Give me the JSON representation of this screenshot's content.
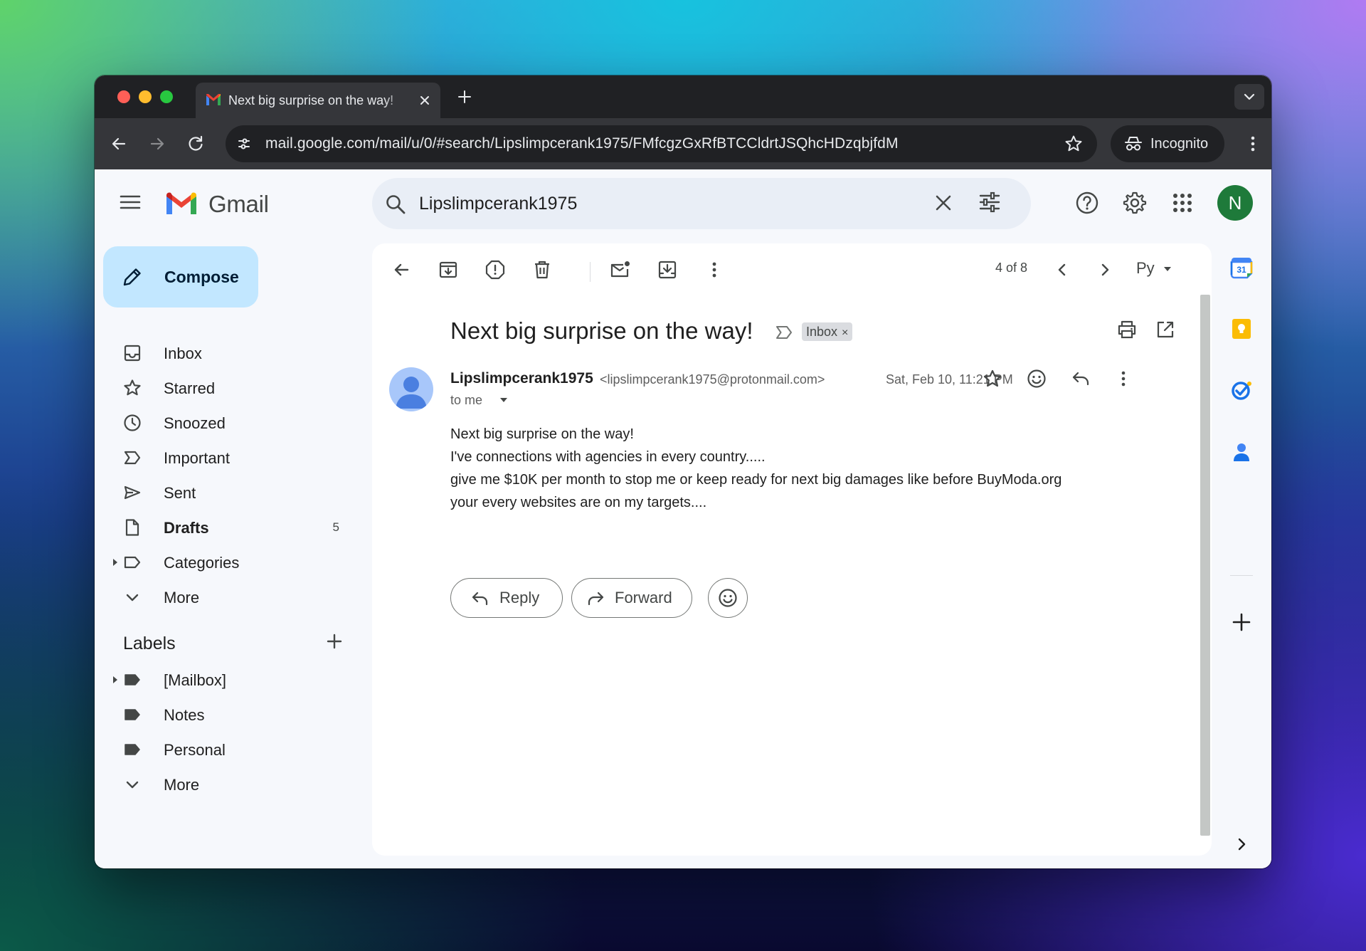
{
  "browser": {
    "tab_title": "Next big surprise on the way!",
    "url": "mail.google.com/mail/u/0/#search/Lipslimpcerank1975/FMfcgzGxRfBTCCldrtJSQhcHDzqbjfdM",
    "incognito_label": "Incognito"
  },
  "gmail": {
    "wordmark": "Gmail",
    "search_value": "Lipslimpcerank1975",
    "avatar_letter": "N"
  },
  "sidebar": {
    "compose_label": "Compose",
    "items": [
      {
        "label": "Inbox",
        "icon": "inbox-icon"
      },
      {
        "label": "Starred",
        "icon": "star-icon"
      },
      {
        "label": "Snoozed",
        "icon": "clock-icon"
      },
      {
        "label": "Important",
        "icon": "important-icon"
      },
      {
        "label": "Sent",
        "icon": "send-icon"
      },
      {
        "label": "Drafts",
        "icon": "draft-icon",
        "count": "5"
      },
      {
        "label": "Categories",
        "icon": "label-outline-icon"
      },
      {
        "label": "More",
        "icon": "chevron-down-icon"
      }
    ],
    "labels_heading": "Labels",
    "labels": [
      {
        "label": "[Mailbox]"
      },
      {
        "label": "Notes"
      },
      {
        "label": "Personal"
      },
      {
        "label": "More"
      }
    ]
  },
  "toolbar": {
    "pager": "4 of 8",
    "language": "Py"
  },
  "message": {
    "subject": "Next big surprise on the way!",
    "inbox_chip": "Inbox",
    "chip_close": "×",
    "sender_name": "Lipslimpcerank1975",
    "sender_email": "<lipslimpcerank1975@protonmail.com>",
    "to": "to me",
    "date": "Sat, Feb 10, 11:21 PM",
    "body": [
      "Next big surprise on the way!",
      "I've connections with agencies in every country.....",
      "give me $10K per month to stop me or keep ready for next big damages like before BuyModa.org",
      "your every websites are on my targets...."
    ],
    "reply_label": "Reply",
    "forward_label": "Forward"
  },
  "side_panel": {
    "calendar_day": "31"
  },
  "colors": {
    "compose_bg": "#c2e7ff",
    "search_bg": "#e9eef6",
    "gmail_bg": "#f6f8fc",
    "avatar_bg": "#1e7a3a",
    "chrome_dark": "#202124",
    "chrome_tab": "#35363a"
  }
}
